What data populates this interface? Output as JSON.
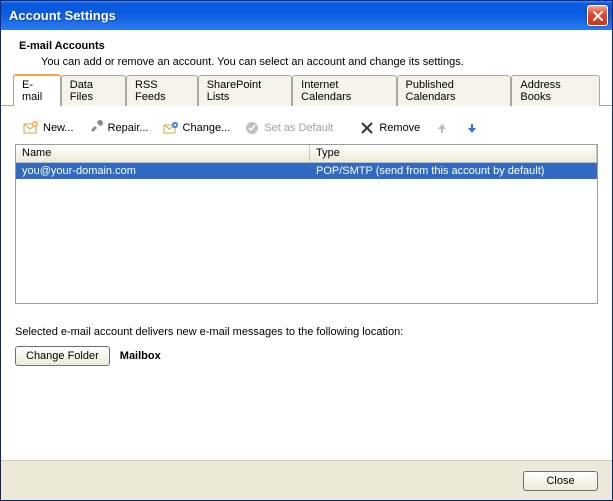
{
  "window": {
    "title": "Account Settings"
  },
  "header": {
    "title": "E-mail Accounts",
    "subtitle": "You can add or remove an account. You can select an account and change its settings."
  },
  "tabs": [
    {
      "label": "E-mail",
      "active": true
    },
    {
      "label": "Data Files"
    },
    {
      "label": "RSS Feeds"
    },
    {
      "label": "SharePoint Lists"
    },
    {
      "label": "Internet Calendars"
    },
    {
      "label": "Published Calendars"
    },
    {
      "label": "Address Books"
    }
  ],
  "toolbar": {
    "new_label": "New...",
    "repair_label": "Repair...",
    "change_label": "Change...",
    "setdefault_label": "Set as Default",
    "remove_label": "Remove"
  },
  "columns": {
    "name": "Name",
    "type": "Type"
  },
  "rows": [
    {
      "name": "you@your-domain.com",
      "type": "POP/SMTP (send from this account by default)",
      "selected": true
    }
  ],
  "delivery": {
    "text": "Selected e-mail account delivers new e-mail messages to the following location:",
    "change_folder_label": "Change Folder",
    "mailbox_label": "Mailbox"
  },
  "footer": {
    "close_label": "Close"
  }
}
